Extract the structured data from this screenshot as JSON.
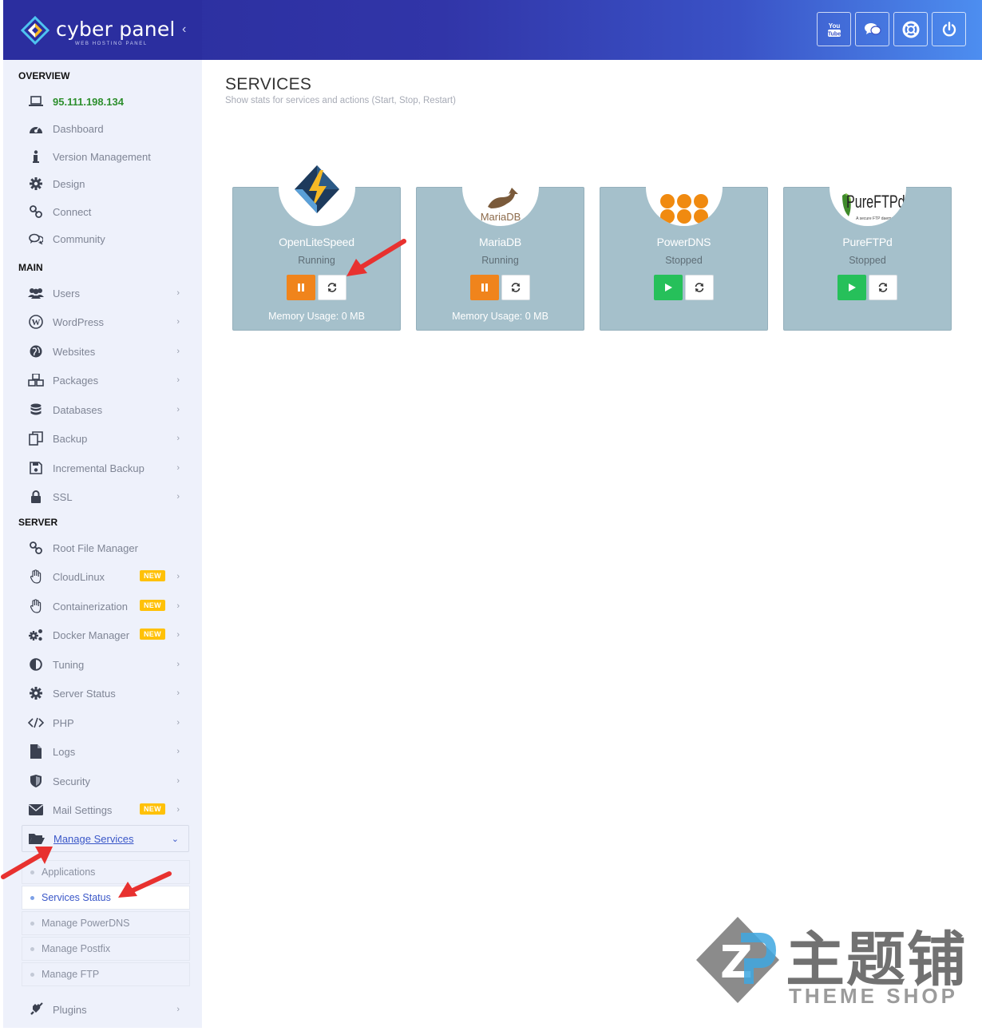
{
  "brand": {
    "name": "cyber panel",
    "subtitle": "WEB HOSTING PANEL",
    "collapse": "‹"
  },
  "topbar_icons": [
    "youtube-icon",
    "chat-icon",
    "support-icon",
    "power-icon"
  ],
  "sidebar": {
    "overview_label": "OVERVIEW",
    "main_label": "MAIN",
    "server_label": "SERVER",
    "overview": [
      {
        "label": "95.111.198.134",
        "icon": "laptop-icon"
      },
      {
        "label": "Dashboard",
        "icon": "dashboard-icon"
      },
      {
        "label": "Version Management",
        "icon": "info-icon"
      },
      {
        "label": "Design",
        "icon": "gear-icon"
      },
      {
        "label": "Connect",
        "icon": "link-icon"
      },
      {
        "label": "Community",
        "icon": "comments-icon"
      }
    ],
    "main": [
      {
        "label": "Users",
        "icon": "users-icon"
      },
      {
        "label": "WordPress",
        "icon": "wordpress-icon"
      },
      {
        "label": "Websites",
        "icon": "globe-icon"
      },
      {
        "label": "Packages",
        "icon": "cubes-icon"
      },
      {
        "label": "Databases",
        "icon": "database-icon"
      },
      {
        "label": "Backup",
        "icon": "copy-icon"
      },
      {
        "label": "Incremental Backup",
        "icon": "save-icon"
      },
      {
        "label": "SSL",
        "icon": "lock-icon"
      }
    ],
    "server": [
      {
        "label": "Root File Manager",
        "icon": "link-icon"
      },
      {
        "label": "CloudLinux",
        "icon": "hand-icon",
        "badge": "NEW"
      },
      {
        "label": "Containerization",
        "icon": "hand-icon",
        "badge": "NEW"
      },
      {
        "label": "Docker Manager",
        "icon": "cogs-icon",
        "badge": "NEW"
      },
      {
        "label": "Tuning",
        "icon": "half-circle-icon"
      },
      {
        "label": "Server Status",
        "icon": "gear-icon"
      },
      {
        "label": "PHP",
        "icon": "code-icon"
      },
      {
        "label": "Logs",
        "icon": "file-icon"
      },
      {
        "label": "Security",
        "icon": "shield-icon"
      },
      {
        "label": "Mail Settings",
        "icon": "envelope-icon",
        "badge": "NEW"
      },
      {
        "label": "Manage Services",
        "icon": "folder-open-icon"
      }
    ],
    "submenu": [
      {
        "label": "Applications"
      },
      {
        "label": "Services Status"
      },
      {
        "label": "Manage PowerDNS"
      },
      {
        "label": "Manage Postfix"
      },
      {
        "label": "Manage FTP"
      }
    ],
    "plugins": {
      "label": "Plugins",
      "icon": "plug-icon"
    }
  },
  "page": {
    "title": "SERVICES",
    "subtitle": "Show stats for services and actions (Start, Stop, Restart)"
  },
  "services": [
    {
      "name": "OpenLiteSpeed",
      "status": "Running",
      "memory": "Memory Usage: 0 MB",
      "action": "pause",
      "logo": "openlitespeed-logo"
    },
    {
      "name": "MariaDB",
      "status": "Running",
      "memory": "Memory Usage: 0 MB",
      "action": "pause",
      "logo": "mariadb-logo",
      "logo_text": "MariaDB"
    },
    {
      "name": "PowerDNS",
      "status": "Stopped",
      "memory": "",
      "action": "play",
      "logo": "powerdns-logo"
    },
    {
      "name": "PureFTPd",
      "status": "Stopped",
      "memory": "",
      "action": "play",
      "logo": "pureftpd-logo",
      "logo_text": "PureFTPd",
      "logo_sub": "A secure FTP daemon"
    }
  ],
  "watermark": {
    "cn": "主题铺",
    "en": "THEME SHOP"
  },
  "colors": {
    "accent": "#3a57c8",
    "topbar": "#2b2e9f",
    "card": "#a5c0cb",
    "pause": "#f0841c",
    "play": "#26c05a",
    "arrow": "#e8312f"
  }
}
